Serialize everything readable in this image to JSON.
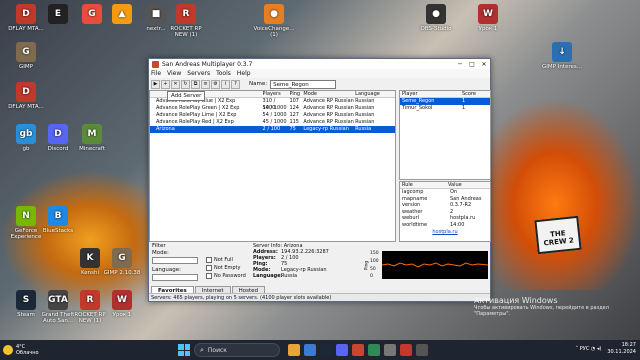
{
  "desktop": {
    "icons": [
      {
        "label": "DFLAY MTA...",
        "color": "#c0392b",
        "glyph": "D"
      },
      {
        "label": "",
        "color": "#222",
        "glyph": "E"
      },
      {
        "label": "",
        "color": "#e74c3c",
        "glyph": "G"
      },
      {
        "label": "",
        "color": "#f39c12",
        "glyph": "▲"
      },
      {
        "label": "nextr...",
        "color": "#555",
        "glyph": "■"
      },
      {
        "label": "ROCKET RP NEW (1)",
        "color": "#c0392b",
        "glyph": "R"
      },
      {
        "label": "VoiceChange... (1)",
        "color": "#e67e22",
        "glyph": "●"
      },
      {
        "label": "OBS-Studio",
        "color": "#333",
        "glyph": "●"
      },
      {
        "label": "Урок 1",
        "color": "#b03030",
        "glyph": "W"
      },
      {
        "label": "GIMP",
        "color": "#7f6b4d",
        "glyph": "G"
      },
      {
        "label": "GIMP Interes...",
        "color": "#2a6fb0",
        "glyph": "↓"
      },
      {
        "label": "DFLAY MTA...",
        "color": "#c0392b",
        "glyph": "D"
      },
      {
        "label": "gb",
        "color": "#2a8fd8",
        "glyph": "gb"
      },
      {
        "label": "Discord",
        "color": "#5865f2",
        "glyph": "D"
      },
      {
        "label": "Minecraft",
        "color": "#5a8b3a",
        "glyph": "M"
      },
      {
        "label": "GeForce Experience",
        "color": "#76b900",
        "glyph": "N"
      },
      {
        "label": "BlueStacks",
        "color": "#1e88e5",
        "glyph": "B"
      },
      {
        "label": "Kenshi",
        "color": "#333",
        "glyph": "K"
      },
      {
        "label": "GIMP 2.10.38",
        "color": "#7f6b4d",
        "glyph": "G"
      },
      {
        "label": "Steam",
        "color": "#1b2838",
        "glyph": "S"
      },
      {
        "label": "Grand Theft Auto San...",
        "color": "#444",
        "glyph": "GTA"
      },
      {
        "label": "ROCKET RP NEW (1)",
        "color": "#c0392b",
        "glyph": "R"
      },
      {
        "label": "Урок 1",
        "color": "#b03030",
        "glyph": "W"
      }
    ],
    "wallpaper_card": "THE CREW 2"
  },
  "window": {
    "title": "San Andreas Multiplayer 0.3.7",
    "menu": [
      "File",
      "View",
      "Servers",
      "Tools",
      "Help"
    ],
    "name_label": "Name:",
    "name_value": "Seme_Regon",
    "tooltip": "Add Server",
    "server_headers": [
      "",
      "Players",
      "Ping",
      "Mode",
      "Language"
    ],
    "servers": [
      {
        "name": "Advance RolePlay Blue | X2 Exp",
        "players": "310 / 1000",
        "ping": "107",
        "mode": "Advance RP Russian",
        "lang": "Russian",
        "selected": false
      },
      {
        "name": "Advance RolePlay Green | X2 Exp",
        "players": "54 / 1000",
        "ping": "124",
        "mode": "Advance RP Russian",
        "lang": "Russian",
        "selected": false
      },
      {
        "name": "Advance RolePlay Lime | X2 Exp",
        "players": "54 / 1000",
        "ping": "127",
        "mode": "Advance RP Russian",
        "lang": "Russian",
        "selected": false
      },
      {
        "name": "Advance RolePlay Red | X2 Exp",
        "players": "45 / 1000",
        "ping": "115",
        "mode": "Advance RP Russian",
        "lang": "Russian",
        "selected": false
      },
      {
        "name": "Arizona",
        "players": "2 / 100",
        "ping": "75",
        "mode": "Legacy-rp Russian",
        "lang": "Russia",
        "selected": true
      }
    ],
    "player_headers": [
      "Player",
      "Score"
    ],
    "players": [
      {
        "name": "Seme_Regon",
        "score": "1",
        "selected": true
      },
      {
        "name": "Timur_Sokol",
        "score": "1",
        "selected": false
      }
    ],
    "rule_headers": [
      "Rule",
      "Value"
    ],
    "rules": [
      {
        "rule": "lagcomp",
        "value": "On"
      },
      {
        "rule": "mapname",
        "value": "San Andreas"
      },
      {
        "rule": "version",
        "value": "0.3.7-R2"
      },
      {
        "rule": "weather",
        "value": "2"
      },
      {
        "rule": "weburl",
        "value": "hostpla.ru"
      },
      {
        "rule": "worldtime",
        "value": "14:00"
      }
    ],
    "rules_link": "hostpla.ru",
    "filter": {
      "title": "Filter",
      "mode_label": "Mode:",
      "language_label": "Language:",
      "not_full": "Not Full",
      "not_empty": "Not Empty",
      "no_password": "No Password"
    },
    "server_info": {
      "title": "Server Info: Arizona",
      "rows": [
        {
          "k": "Address:",
          "v": "194.93.2.226:3287"
        },
        {
          "k": "Players:",
          "v": "2 / 100"
        },
        {
          "k": "Ping:",
          "v": "75"
        },
        {
          "k": "Mode:",
          "v": "Legacy-rp Russian"
        },
        {
          "k": "Language:",
          "v": "Russia"
        }
      ]
    },
    "ping_graph": {
      "label": "Ping",
      "ticks": [
        "150",
        "100",
        "50",
        "0"
      ],
      "color": "#ff6a00"
    },
    "tabs": [
      "Favorites",
      "Internet",
      "Hosted"
    ],
    "status": "Servers: 465 players, playing on 5 servers. (4100 player slots available)"
  },
  "activation": {
    "title": "Активация Windows",
    "line1": "Чтобы активировать Windows, перейдите в раздел",
    "line2": "\"Параметры\"."
  },
  "taskbar": {
    "weather_temp": "4°C",
    "weather_desc": "Облачно",
    "search_placeholder": "Поиск",
    "lang": "РУС",
    "time": "18:27",
    "date": "30.11.2024",
    "app_colors": [
      "#e8a33b",
      "#3a7bd5",
      "#1b2838",
      "#5865f2",
      "#c7472f",
      "#2e8b57",
      "#777",
      "#c0392b",
      "#555"
    ]
  }
}
